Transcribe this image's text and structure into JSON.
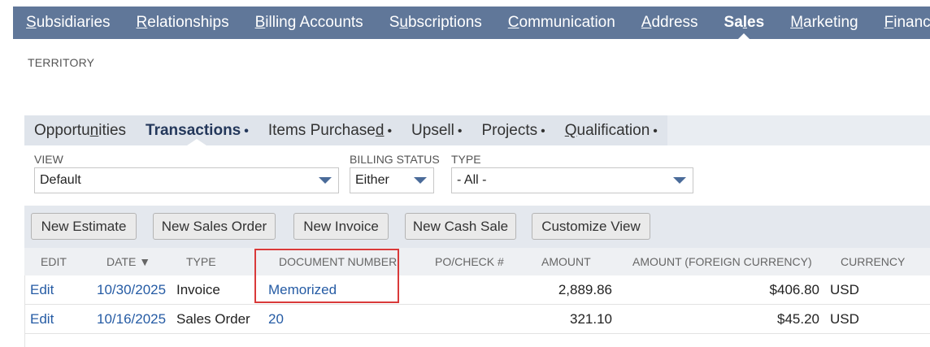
{
  "topnav": {
    "tabs": [
      {
        "pre": "",
        "u": "S",
        "post": "ubsidiaries",
        "active": false
      },
      {
        "pre": "",
        "u": "R",
        "post": "elationships",
        "active": false
      },
      {
        "pre": "",
        "u": "B",
        "post": "illing Accounts",
        "active": false
      },
      {
        "pre": "S",
        "u": "u",
        "post": "bscriptions",
        "active": false
      },
      {
        "pre": "",
        "u": "C",
        "post": "ommunication",
        "active": false
      },
      {
        "pre": "",
        "u": "A",
        "post": "ddress",
        "active": false
      },
      {
        "pre": "Sa",
        "u": "l",
        "post": "es",
        "active": true
      },
      {
        "pre": "",
        "u": "M",
        "post": "arketing",
        "active": false
      },
      {
        "pre": "",
        "u": "F",
        "post": "inancial",
        "active": false
      }
    ]
  },
  "section_label": "TERRITORY",
  "subtabs": [
    {
      "pre": "Opportu",
      "u": "n",
      "post": "ities",
      "dot": "",
      "active": false
    },
    {
      "pre": "Transactions",
      "u": "",
      "post": "",
      "dot": "•",
      "active": true
    },
    {
      "pre": "Items Purchase",
      "u": "d",
      "post": "",
      "dot": "•",
      "active": false
    },
    {
      "pre": "Upsell",
      "u": "",
      "post": "",
      "dot": "•",
      "active": false
    },
    {
      "pre": "Projects",
      "u": "",
      "post": "",
      "dot": "•",
      "active": false
    },
    {
      "pre": "",
      "u": "Q",
      "post": "ualification",
      "dot": "•",
      "active": false
    }
  ],
  "filters": {
    "view_label": "VIEW",
    "view_value": "Default",
    "billing_label": "BILLING STATUS",
    "billing_value": "Either",
    "type_label": "TYPE",
    "type_value": "- All -"
  },
  "buttons": {
    "new_estimate": "New Estimate",
    "new_sales_order": "New Sales Order",
    "new_invoice": "New Invoice",
    "new_cash_sale": "New Cash Sale",
    "customize_view": "Customize View"
  },
  "table": {
    "headers": {
      "edit": "EDIT",
      "date": "DATE ▼",
      "type": "TYPE",
      "doc": "DOCUMENT NUMBER",
      "po": "PO/CHECK #",
      "amount": "AMOUNT",
      "amount_fc": "AMOUNT (FOREIGN CURRENCY)",
      "currency": "CURRENCY"
    },
    "rows": [
      {
        "edit": "Edit",
        "date": "10/30/2025",
        "type": "Invoice",
        "doc": "Memorized",
        "po": "",
        "amount": "2,889.86",
        "amount_fc": "$406.80",
        "currency": "USD"
      },
      {
        "edit": "Edit",
        "date": "10/16/2025",
        "type": "Sales Order",
        "doc": "20",
        "po": "",
        "amount": "321.10",
        "amount_fc": "$45.20",
        "currency": "USD"
      }
    ]
  },
  "colors": {
    "nav_bg": "#607799",
    "link": "#255ba4",
    "highlight": "#d93a3a"
  }
}
